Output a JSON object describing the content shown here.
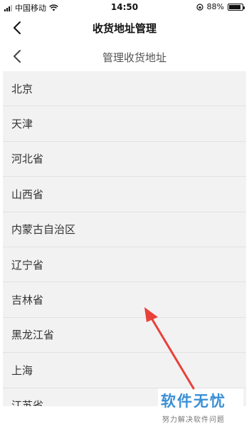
{
  "status_bar": {
    "carrier": "中国移动",
    "time": "14:50",
    "battery": "88%",
    "battery_level": 0.88
  },
  "navbar": {
    "title": "收货地址管理",
    "back_icon": "chevron-left-icon"
  },
  "subheader": {
    "title": "管理收货地址",
    "back_icon": "chevron-left-icon"
  },
  "provinces": [
    "北京",
    "天津",
    "河北省",
    "山西省",
    "内蒙古自治区",
    "辽宁省",
    "吉林省",
    "黑龙江省",
    "上海",
    "江苏省"
  ],
  "watermark": {
    "main": "软件无忧",
    "sub": "努力解决软件问题"
  },
  "colors": {
    "list_bg": "#f2f2f2",
    "arrow": "#e8413a",
    "watermark": "#3a8fd6"
  }
}
